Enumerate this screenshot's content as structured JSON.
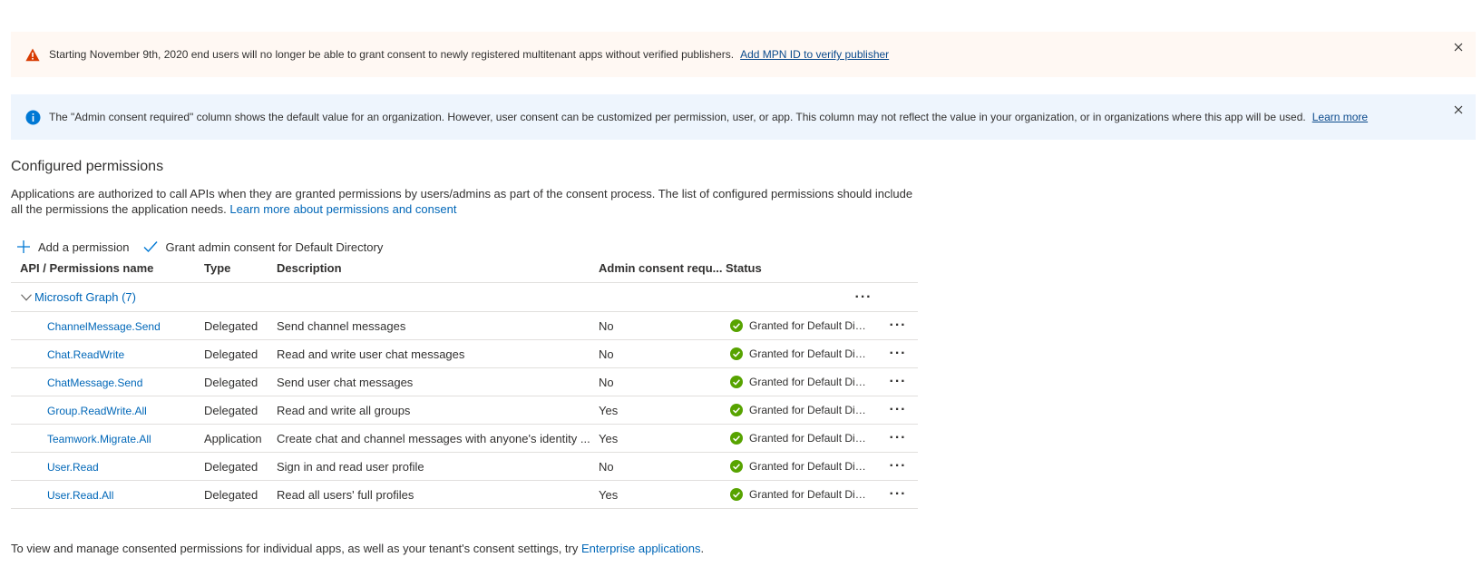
{
  "banners": {
    "warning": {
      "text": "Starting November 9th, 2020 end users will no longer be able to grant consent to newly registered multitenant apps without verified publishers.",
      "link": "Add MPN ID to verify publisher",
      "icon": "warning-icon",
      "bg": "#fff8f3"
    },
    "info": {
      "text": "The \"Admin consent required\" column shows the default value for an organization. However, user consent can be customized per permission, user, or app. This column may not reflect the value in your organization, or in organizations where this app will be used.",
      "link": "Learn more",
      "icon": "info-icon",
      "bg": "#eef5fd"
    }
  },
  "section": {
    "title": "Configured permissions",
    "description": "Applications are authorized to call APIs when they are granted permissions by users/admins as part of the consent process. The list of configured permissions should include all the permissions the application needs.",
    "link": "Learn more about permissions and consent"
  },
  "toolbar": {
    "add_label": "Add a permission",
    "grant_label": "Grant admin consent for Default Directory"
  },
  "table": {
    "headers": {
      "name": "API / Permissions name",
      "type": "Type",
      "description": "Description",
      "admin": "Admin consent requ...",
      "status": "Status"
    },
    "group": {
      "label": "Microsoft Graph (7)"
    },
    "rows": [
      {
        "name": "ChannelMessage.Send",
        "type": "Delegated",
        "description": "Send channel messages",
        "admin": "No",
        "status": "Granted for Default Dire..."
      },
      {
        "name": "Chat.ReadWrite",
        "type": "Delegated",
        "description": "Read and write user chat messages",
        "admin": "No",
        "status": "Granted for Default Dire..."
      },
      {
        "name": "ChatMessage.Send",
        "type": "Delegated",
        "description": "Send user chat messages",
        "admin": "No",
        "status": "Granted for Default Dire..."
      },
      {
        "name": "Group.ReadWrite.All",
        "type": "Delegated",
        "description": "Read and write all groups",
        "admin": "Yes",
        "status": "Granted for Default Dire..."
      },
      {
        "name": "Teamwork.Migrate.All",
        "type": "Application",
        "description": "Create chat and channel messages with anyone's identity ...",
        "admin": "Yes",
        "status": "Granted for Default Dire..."
      },
      {
        "name": "User.Read",
        "type": "Delegated",
        "description": "Sign in and read user profile",
        "admin": "No",
        "status": "Granted for Default Dire..."
      },
      {
        "name": "User.Read.All",
        "type": "Delegated",
        "description": "Read all users' full profiles",
        "admin": "Yes",
        "status": "Granted for Default Dire..."
      }
    ]
  },
  "footer": {
    "text": "To view and manage consented permissions for individual apps, as well as your tenant's consent settings, try",
    "link": "Enterprise applications",
    "suffix": "."
  },
  "colors": {
    "link": "#0067b8",
    "success": "#57a300",
    "warning": "#d83b01",
    "info": "#0078d4"
  }
}
